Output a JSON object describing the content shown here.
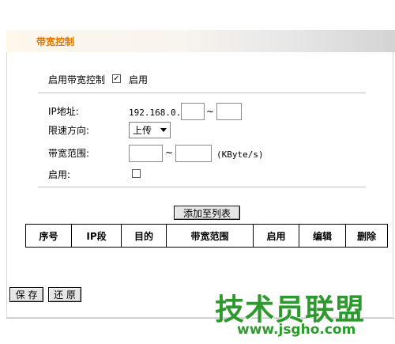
{
  "title": "带宽控制",
  "enable_control": {
    "label": "启用带宽控制",
    "checked": true,
    "checkbox_text": "启用"
  },
  "ip": {
    "label": "IP地址:",
    "prefix": "192.168.0.",
    "start": "",
    "end": "",
    "separator": "~"
  },
  "direction": {
    "label": "限速方向:",
    "selected": "上传"
  },
  "bandwidth": {
    "label": "带宽范围:",
    "min": "",
    "max": "",
    "separator": "~",
    "unit": "(KByte/s)"
  },
  "enable_rule": {
    "label": "启用:",
    "checked": false
  },
  "add_button": "添加至列表",
  "table": {
    "headers": [
      "序号",
      "IP段",
      "目的",
      "带宽范围",
      "启用",
      "编辑",
      "删除"
    ]
  },
  "footer": {
    "save": "保 存",
    "restore": "还 原"
  },
  "watermark": {
    "text": "技术员联盟",
    "url": "www.jsgho.com"
  },
  "colors": {
    "title": "#e07800",
    "watermark": "#2e9a2e"
  }
}
